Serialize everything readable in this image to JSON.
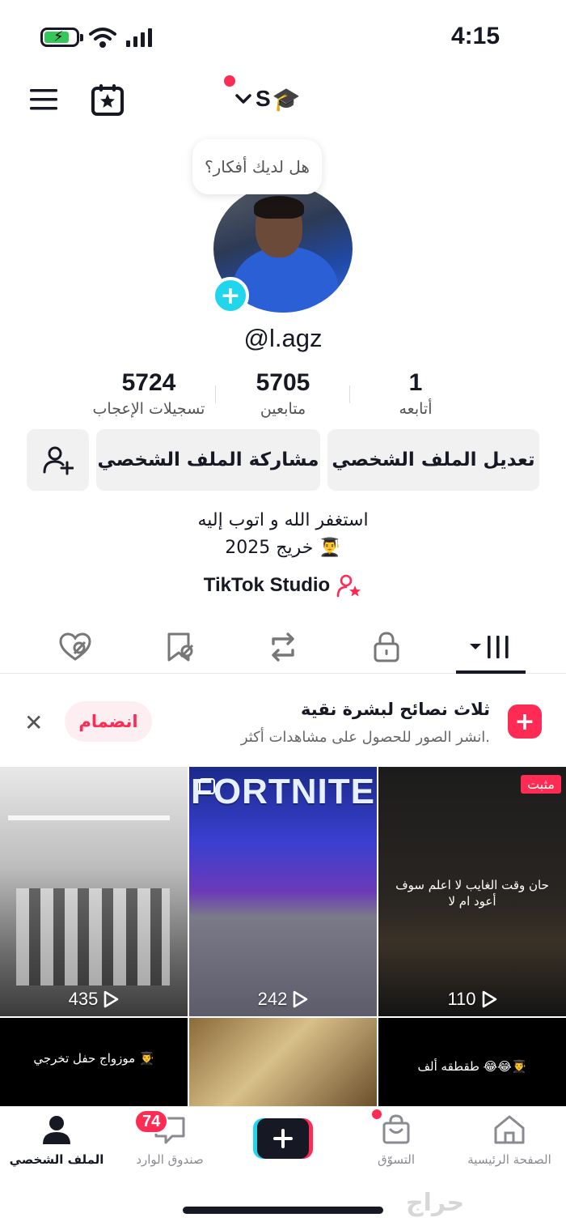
{
  "status": {
    "time": "4:15"
  },
  "header": {
    "display_name": "S",
    "display_emoji": "🎓"
  },
  "profile": {
    "thought_prompt": "هل لديك أفكار؟",
    "username": "@l.agz",
    "stats": [
      {
        "value": "5724",
        "label": "تسجيلات الإعجاب"
      },
      {
        "value": "5705",
        "label": "متابعين"
      },
      {
        "value": "1",
        "label": "أتابعه"
      }
    ],
    "buttons": {
      "edit": "تعديل الملف الشخصي",
      "share": "مشاركة الملف الشخصي"
    },
    "bio": [
      "استغفر الله و اتوب إليه",
      "خريج 2025 👨‍🎓"
    ],
    "studio": "TikTok Studio"
  },
  "banner": {
    "title": "ثلاث نصائح لبشرة نقية",
    "subtitle": "انشر الصور للحصول على مشاهدات أكثر.",
    "join": "انضمام",
    "close": "✕"
  },
  "videos": [
    {
      "views": "435"
    },
    {
      "views": "242",
      "title": "FORTNITE"
    },
    {
      "views": "110",
      "pinned": "مثبت",
      "caption": "حان وقت الغايب لا اعلم سوف أعود ام لا"
    },
    {
      "caption": "موزواج حفل تخرجي 👨‍🎓"
    },
    {},
    {
      "caption": "طقطقه ألف 😂😂👨‍🎓"
    }
  ],
  "bottom_nav": {
    "home": "الصفحة الرئيسية",
    "shop": "التسوّق",
    "inbox": "صندوق الوارد",
    "profile": "الملف الشخصي",
    "inbox_badge": "74"
  },
  "watermark": "حراج",
  "colors": {
    "accent": "#fe2c55",
    "cyan": "#20d5ec"
  }
}
